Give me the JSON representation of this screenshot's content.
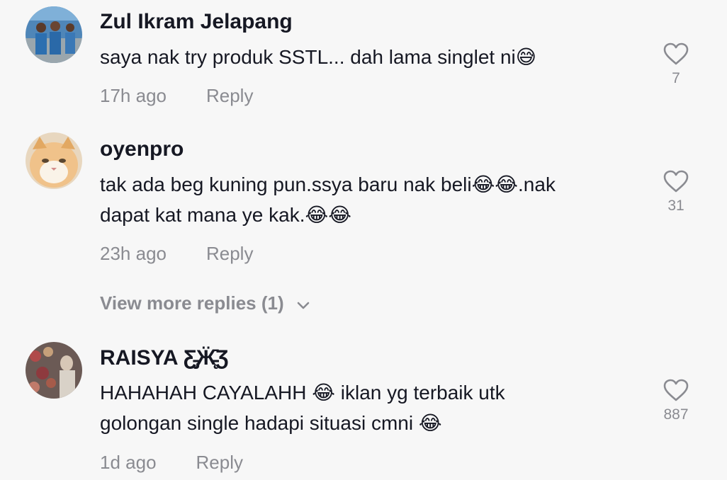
{
  "comments": [
    {
      "username": "Zul Ikram Jelapang",
      "text": "saya nak try produk SSTL... dah lama singlet ni😅",
      "time": "17h ago",
      "reply_label": "Reply",
      "likes": "7",
      "avatar_icon": "user-photo-avatar"
    },
    {
      "username": "oyenpro",
      "text": "tak ada beg kuning pun.ssya baru nak beli😂😂.nak dapat kat mana ye kak.😂😂",
      "time": "23h ago",
      "reply_label": "Reply",
      "likes": "31",
      "avatar_icon": "cat-photo-avatar"
    },
    {
      "username": "RAISYA Ƹ̵̡Ӝ̵̨̄Ʒ",
      "text": "HAHAHAH CAYALAHH 😂 iklan yg terbaik utk golongan single hadapi situasi cmni 😂",
      "time": "1d ago",
      "reply_label": "Reply",
      "likes": "887",
      "avatar_icon": "user-photo-avatar"
    }
  ],
  "view_more": {
    "label": "View more replies (1)"
  },
  "colors": {
    "text": "#161823",
    "muted": "#8a8b91",
    "background": "#f7f7f7"
  }
}
